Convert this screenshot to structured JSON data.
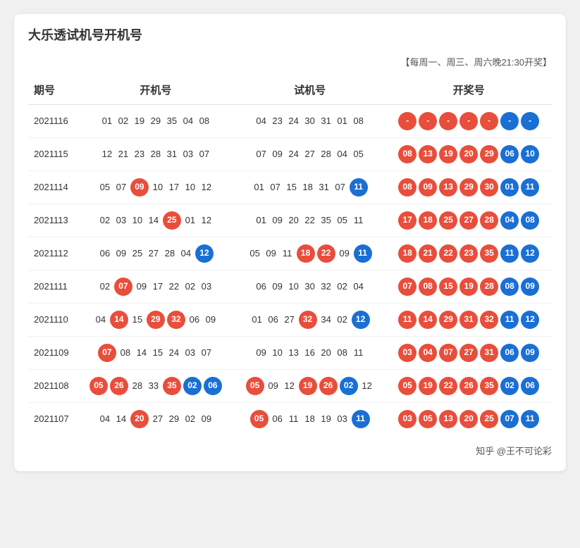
{
  "title": "大乐透试机号开机号",
  "schedule": "【每周一、周三、周六晚21:30开奖】",
  "columns": [
    "期号",
    "开机号",
    "试机号",
    "开奖号"
  ],
  "rows": [
    {
      "id": "2021116",
      "kaiji": [
        {
          "num": "01",
          "type": "plain"
        },
        {
          "num": "02",
          "type": "plain"
        },
        {
          "num": "19",
          "type": "plain"
        },
        {
          "num": "29",
          "type": "plain"
        },
        {
          "num": "35",
          "type": "plain"
        },
        {
          "num": "04",
          "type": "plain"
        },
        {
          "num": "08",
          "type": "plain"
        }
      ],
      "shiji": [
        {
          "num": "04",
          "type": "plain"
        },
        {
          "num": "23",
          "type": "plain"
        },
        {
          "num": "24",
          "type": "plain"
        },
        {
          "num": "30",
          "type": "plain"
        },
        {
          "num": "31",
          "type": "plain"
        },
        {
          "num": "01",
          "type": "plain"
        },
        {
          "num": "08",
          "type": "plain"
        }
      ],
      "kaijang": [
        {
          "num": "-",
          "type": "red"
        },
        {
          "num": "-",
          "type": "red"
        },
        {
          "num": "-",
          "type": "red"
        },
        {
          "num": "-",
          "type": "red"
        },
        {
          "num": "-",
          "type": "red"
        },
        {
          "num": "-",
          "type": "blue"
        },
        {
          "num": "-",
          "type": "blue"
        }
      ]
    },
    {
      "id": "2021115",
      "kaiji": [
        {
          "num": "12",
          "type": "plain"
        },
        {
          "num": "21",
          "type": "plain"
        },
        {
          "num": "23",
          "type": "plain"
        },
        {
          "num": "28",
          "type": "plain"
        },
        {
          "num": "31",
          "type": "plain"
        },
        {
          "num": "03",
          "type": "plain"
        },
        {
          "num": "07",
          "type": "plain"
        }
      ],
      "shiji": [
        {
          "num": "07",
          "type": "plain"
        },
        {
          "num": "09",
          "type": "plain"
        },
        {
          "num": "24",
          "type": "plain"
        },
        {
          "num": "27",
          "type": "plain"
        },
        {
          "num": "28",
          "type": "plain"
        },
        {
          "num": "04",
          "type": "plain"
        },
        {
          "num": "05",
          "type": "plain"
        }
      ],
      "kaijang": [
        {
          "num": "08",
          "type": "red"
        },
        {
          "num": "13",
          "type": "red"
        },
        {
          "num": "19",
          "type": "red"
        },
        {
          "num": "20",
          "type": "red"
        },
        {
          "num": "29",
          "type": "red"
        },
        {
          "num": "06",
          "type": "blue"
        },
        {
          "num": "10",
          "type": "blue"
        }
      ]
    },
    {
      "id": "2021114",
      "kaiji": [
        {
          "num": "05",
          "type": "plain"
        },
        {
          "num": "07",
          "type": "plain"
        },
        {
          "num": "09",
          "type": "red"
        },
        {
          "num": "10",
          "type": "plain"
        },
        {
          "num": "17",
          "type": "plain"
        },
        {
          "num": "10",
          "type": "plain"
        },
        {
          "num": "12",
          "type": "plain"
        }
      ],
      "shiji": [
        {
          "num": "01",
          "type": "plain"
        },
        {
          "num": "07",
          "type": "plain"
        },
        {
          "num": "15",
          "type": "plain"
        },
        {
          "num": "18",
          "type": "plain"
        },
        {
          "num": "31",
          "type": "plain"
        },
        {
          "num": "07",
          "type": "plain"
        },
        {
          "num": "11",
          "type": "blue"
        }
      ],
      "kaijang": [
        {
          "num": "08",
          "type": "red"
        },
        {
          "num": "09",
          "type": "red"
        },
        {
          "num": "13",
          "type": "red"
        },
        {
          "num": "29",
          "type": "red"
        },
        {
          "num": "30",
          "type": "red"
        },
        {
          "num": "01",
          "type": "blue"
        },
        {
          "num": "11",
          "type": "blue"
        }
      ]
    },
    {
      "id": "2021113",
      "kaiji": [
        {
          "num": "02",
          "type": "plain"
        },
        {
          "num": "03",
          "type": "plain"
        },
        {
          "num": "10",
          "type": "plain"
        },
        {
          "num": "14",
          "type": "plain"
        },
        {
          "num": "25",
          "type": "red"
        },
        {
          "num": "01",
          "type": "plain"
        },
        {
          "num": "12",
          "type": "plain"
        }
      ],
      "shiji": [
        {
          "num": "01",
          "type": "plain"
        },
        {
          "num": "09",
          "type": "plain"
        },
        {
          "num": "20",
          "type": "plain"
        },
        {
          "num": "22",
          "type": "plain"
        },
        {
          "num": "35",
          "type": "plain"
        },
        {
          "num": "05",
          "type": "plain"
        },
        {
          "num": "11",
          "type": "plain"
        }
      ],
      "kaijang": [
        {
          "num": "17",
          "type": "red"
        },
        {
          "num": "18",
          "type": "red"
        },
        {
          "num": "25",
          "type": "red"
        },
        {
          "num": "27",
          "type": "red"
        },
        {
          "num": "28",
          "type": "red"
        },
        {
          "num": "04",
          "type": "blue"
        },
        {
          "num": "08",
          "type": "blue"
        }
      ]
    },
    {
      "id": "2021112",
      "kaiji": [
        {
          "num": "06",
          "type": "plain"
        },
        {
          "num": "09",
          "type": "plain"
        },
        {
          "num": "25",
          "type": "plain"
        },
        {
          "num": "27",
          "type": "plain"
        },
        {
          "num": "28",
          "type": "plain"
        },
        {
          "num": "04",
          "type": "plain"
        },
        {
          "num": "12",
          "type": "blue"
        }
      ],
      "shiji": [
        {
          "num": "05",
          "type": "plain"
        },
        {
          "num": "09",
          "type": "plain"
        },
        {
          "num": "11",
          "type": "plain"
        },
        {
          "num": "18",
          "type": "red"
        },
        {
          "num": "22",
          "type": "red"
        },
        {
          "num": "09",
          "type": "plain"
        },
        {
          "num": "11",
          "type": "blue"
        }
      ],
      "kaijang": [
        {
          "num": "18",
          "type": "red"
        },
        {
          "num": "21",
          "type": "red"
        },
        {
          "num": "22",
          "type": "red"
        },
        {
          "num": "23",
          "type": "red"
        },
        {
          "num": "35",
          "type": "red"
        },
        {
          "num": "11",
          "type": "blue"
        },
        {
          "num": "12",
          "type": "blue"
        }
      ]
    },
    {
      "id": "2021111",
      "kaiji": [
        {
          "num": "02",
          "type": "plain"
        },
        {
          "num": "07",
          "type": "red"
        },
        {
          "num": "09",
          "type": "plain"
        },
        {
          "num": "17",
          "type": "plain"
        },
        {
          "num": "22",
          "type": "plain"
        },
        {
          "num": "02",
          "type": "plain"
        },
        {
          "num": "03",
          "type": "plain"
        }
      ],
      "shiji": [
        {
          "num": "06",
          "type": "plain"
        },
        {
          "num": "09",
          "type": "plain"
        },
        {
          "num": "10",
          "type": "plain"
        },
        {
          "num": "30",
          "type": "plain"
        },
        {
          "num": "32",
          "type": "plain"
        },
        {
          "num": "02",
          "type": "plain"
        },
        {
          "num": "04",
          "type": "plain"
        }
      ],
      "kaijang": [
        {
          "num": "07",
          "type": "red"
        },
        {
          "num": "08",
          "type": "red"
        },
        {
          "num": "15",
          "type": "red"
        },
        {
          "num": "19",
          "type": "red"
        },
        {
          "num": "28",
          "type": "red"
        },
        {
          "num": "08",
          "type": "blue"
        },
        {
          "num": "09",
          "type": "blue"
        }
      ]
    },
    {
      "id": "2021110",
      "kaiji": [
        {
          "num": "04",
          "type": "plain"
        },
        {
          "num": "14",
          "type": "red"
        },
        {
          "num": "15",
          "type": "plain"
        },
        {
          "num": "29",
          "type": "red"
        },
        {
          "num": "32",
          "type": "red"
        },
        {
          "num": "06",
          "type": "plain"
        },
        {
          "num": "09",
          "type": "plain"
        }
      ],
      "shiji": [
        {
          "num": "01",
          "type": "plain"
        },
        {
          "num": "06",
          "type": "plain"
        },
        {
          "num": "27",
          "type": "plain"
        },
        {
          "num": "32",
          "type": "red"
        },
        {
          "num": "34",
          "type": "plain"
        },
        {
          "num": "02",
          "type": "plain"
        },
        {
          "num": "12",
          "type": "blue"
        }
      ],
      "kaijang": [
        {
          "num": "11",
          "type": "red"
        },
        {
          "num": "14",
          "type": "red"
        },
        {
          "num": "29",
          "type": "red"
        },
        {
          "num": "31",
          "type": "red"
        },
        {
          "num": "32",
          "type": "red"
        },
        {
          "num": "11",
          "type": "blue"
        },
        {
          "num": "12",
          "type": "blue"
        }
      ]
    },
    {
      "id": "2021109",
      "kaiji": [
        {
          "num": "07",
          "type": "red"
        },
        {
          "num": "08",
          "type": "plain"
        },
        {
          "num": "14",
          "type": "plain"
        },
        {
          "num": "15",
          "type": "plain"
        },
        {
          "num": "24",
          "type": "plain"
        },
        {
          "num": "03",
          "type": "plain"
        },
        {
          "num": "07",
          "type": "plain"
        }
      ],
      "shiji": [
        {
          "num": "09",
          "type": "plain"
        },
        {
          "num": "10",
          "type": "plain"
        },
        {
          "num": "13",
          "type": "plain"
        },
        {
          "num": "16",
          "type": "plain"
        },
        {
          "num": "20",
          "type": "plain"
        },
        {
          "num": "08",
          "type": "plain"
        },
        {
          "num": "11",
          "type": "plain"
        }
      ],
      "kaijang": [
        {
          "num": "03",
          "type": "red"
        },
        {
          "num": "04",
          "type": "red"
        },
        {
          "num": "07",
          "type": "red"
        },
        {
          "num": "27",
          "type": "red"
        },
        {
          "num": "31",
          "type": "red"
        },
        {
          "num": "06",
          "type": "blue"
        },
        {
          "num": "09",
          "type": "blue"
        }
      ]
    },
    {
      "id": "2021108",
      "kaiji": [
        {
          "num": "05",
          "type": "red"
        },
        {
          "num": "26",
          "type": "red"
        },
        {
          "num": "28",
          "type": "plain"
        },
        {
          "num": "33",
          "type": "plain"
        },
        {
          "num": "35",
          "type": "red"
        },
        {
          "num": "02",
          "type": "blue"
        },
        {
          "num": "06",
          "type": "blue"
        }
      ],
      "shiji": [
        {
          "num": "05",
          "type": "red"
        },
        {
          "num": "09",
          "type": "plain"
        },
        {
          "num": "12",
          "type": "plain"
        },
        {
          "num": "19",
          "type": "red"
        },
        {
          "num": "26",
          "type": "red"
        },
        {
          "num": "02",
          "type": "blue"
        },
        {
          "num": "12",
          "type": "plain"
        }
      ],
      "kaijang": [
        {
          "num": "05",
          "type": "red"
        },
        {
          "num": "19",
          "type": "red"
        },
        {
          "num": "22",
          "type": "red"
        },
        {
          "num": "26",
          "type": "red"
        },
        {
          "num": "35",
          "type": "red"
        },
        {
          "num": "02",
          "type": "blue"
        },
        {
          "num": "06",
          "type": "blue"
        }
      ]
    },
    {
      "id": "2021107",
      "kaiji": [
        {
          "num": "04",
          "type": "plain"
        },
        {
          "num": "14",
          "type": "plain"
        },
        {
          "num": "20",
          "type": "red"
        },
        {
          "num": "27",
          "type": "plain"
        },
        {
          "num": "29",
          "type": "plain"
        },
        {
          "num": "02",
          "type": "plain"
        },
        {
          "num": "09",
          "type": "plain"
        }
      ],
      "shiji": [
        {
          "num": "05",
          "type": "red"
        },
        {
          "num": "06",
          "type": "plain"
        },
        {
          "num": "11",
          "type": "plain"
        },
        {
          "num": "18",
          "type": "plain"
        },
        {
          "num": "19",
          "type": "plain"
        },
        {
          "num": "03",
          "type": "plain"
        },
        {
          "num": "11",
          "type": "blue"
        }
      ],
      "kaijang": [
        {
          "num": "03",
          "type": "red"
        },
        {
          "num": "05",
          "type": "red"
        },
        {
          "num": "13",
          "type": "red"
        },
        {
          "num": "20",
          "type": "red"
        },
        {
          "num": "25",
          "type": "red"
        },
        {
          "num": "07",
          "type": "blue"
        },
        {
          "num": "11",
          "type": "blue"
        }
      ]
    }
  ],
  "footer": {
    "watermark": "知乎 @王不可论彩"
  }
}
